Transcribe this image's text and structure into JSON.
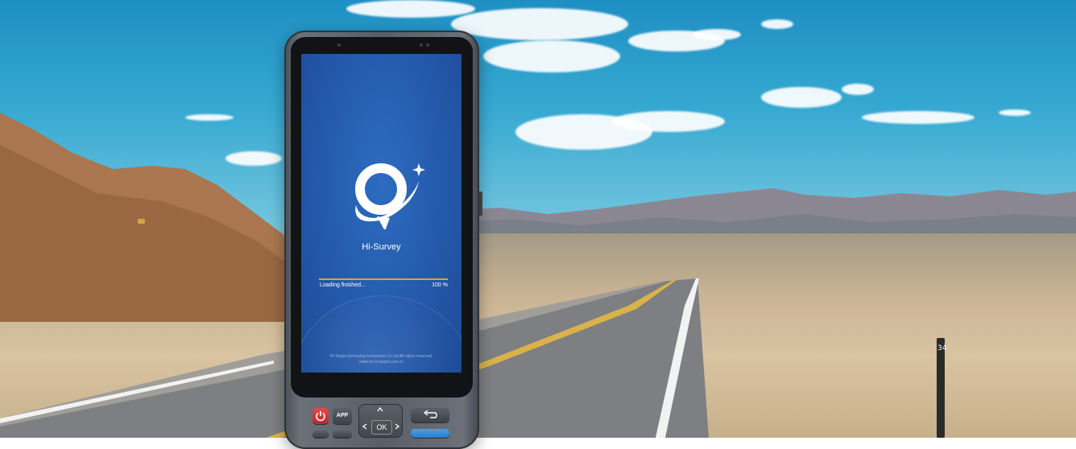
{
  "app": {
    "name": "Hi-Survey",
    "icon": "hi-survey-logo-icon"
  },
  "loading": {
    "status": "Loading finished...",
    "percent_label": "100 %",
    "progress": 1.0
  },
  "footer": {
    "copyright": "Hi-Target Surveying Instrument Co.Ltd All rights reserved.",
    "website": "www.en.hi-target.com.cn"
  },
  "keypad": {
    "power_icon": "power-icon",
    "app_label": "APP",
    "ok_label": "OK",
    "back_icon": "back-arrow-icon",
    "up_icon": "chevron-up-icon",
    "left_icon": "chevron-left-icon",
    "right_icon": "chevron-right-icon"
  },
  "scene": {
    "marker_post_label": "34"
  },
  "colors": {
    "screen_blue": "#2459ab",
    "progress_accent": "#d9a24a",
    "power_key": "#d33a3a",
    "sky": "#2f9fce"
  }
}
